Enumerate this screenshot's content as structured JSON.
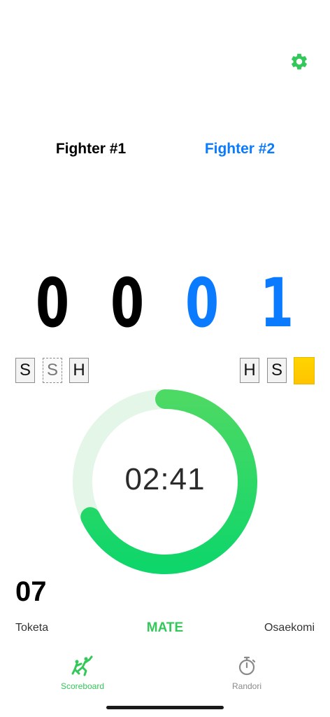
{
  "fighters": {
    "fighter1": {
      "name": "Fighter #1",
      "score": [
        "0",
        "0"
      ]
    },
    "fighter2": {
      "name": "Fighter #2",
      "score": [
        "0",
        "1"
      ]
    }
  },
  "penalties": {
    "fighter1": [
      {
        "label": "S",
        "style": "solid"
      },
      {
        "label": "S",
        "style": "dashed"
      },
      {
        "label": "H",
        "style": "solid"
      }
    ],
    "fighter2": [
      {
        "label": "H",
        "style": "solid"
      },
      {
        "label": "S",
        "style": "solid"
      }
    ],
    "fighter2_card": "yellow"
  },
  "timer": {
    "display": "02:41",
    "progress": 0.68
  },
  "counter": "07",
  "controls": {
    "left_label": "Toketa",
    "center_label": "MATE",
    "right_label": "Osaekomi"
  },
  "tabbar": {
    "tabs": [
      {
        "label": "Scoreboard",
        "icon": "judo-throw-icon",
        "active": true
      },
      {
        "label": "Randori",
        "icon": "stopwatch-icon",
        "active": false
      }
    ]
  },
  "colors": {
    "accent_green": "#34C759",
    "fighter2_blue": "#0A7AFF",
    "card_yellow": "#FFD400"
  }
}
